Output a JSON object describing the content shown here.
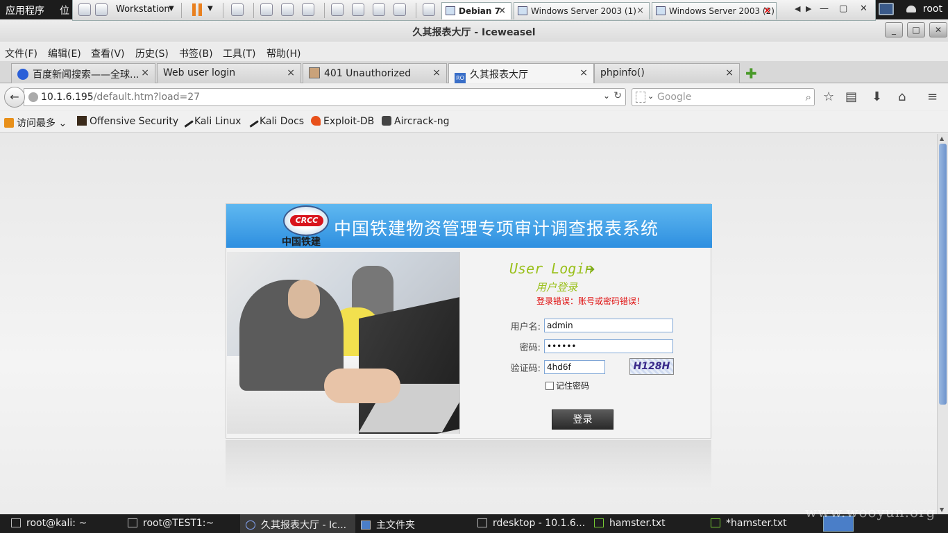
{
  "system": {
    "apps": "应用程序",
    "places": "位",
    "user": "root"
  },
  "vmware": {
    "workstation": "Workstation",
    "tabs": [
      {
        "label": "Debian 7",
        "active": true
      },
      {
        "label": "Windows Server 2003 (1)",
        "active": false
      },
      {
        "label": "Windows Server 2003 (2)",
        "active": false
      }
    ]
  },
  "window": {
    "title": "久其报表大厅 - Iceweasel"
  },
  "menu": [
    "文件(F)",
    "编辑(E)",
    "查看(V)",
    "历史(S)",
    "书签(B)",
    "工具(T)",
    "帮助(H)"
  ],
  "tabs": [
    {
      "label": "百度新闻搜索——全球...",
      "active": false
    },
    {
      "label": "Web user login",
      "active": false
    },
    {
      "label": "401 Unauthorized",
      "active": false
    },
    {
      "label": "久其报表大厅",
      "active": true
    },
    {
      "label": "phpinfo()",
      "active": false
    }
  ],
  "nav": {
    "url_host": "10.1.6.195",
    "url_path": "/default.htm?load=27",
    "search_placeholder": "Google"
  },
  "bookmarks": [
    "访问最多",
    "Offensive Security",
    "Kali Linux",
    "Kali Docs",
    "Exploit-DB",
    "Aircrack-ng"
  ],
  "page": {
    "logo_text": "CRCC",
    "logo_name": "中国铁建",
    "banner_title": "中国铁建物资管理专项审计调查报表系统",
    "login_title": "User Login",
    "login_title_cn": "用户登录",
    "error": "登录错误：账号或密码错误！",
    "username_label": "用户名:",
    "username_value": "admin",
    "password_label": "密码:",
    "password_value": "••••••",
    "captcha_label": "验证码:",
    "captcha_value": "4hd6f",
    "captcha_image_text": "H128H",
    "remember_label": "记住密码",
    "login_button": "登录"
  },
  "taskbar": [
    {
      "label": "root@kali: ~",
      "active": false
    },
    {
      "label": "root@TEST1:~",
      "active": false
    },
    {
      "label": "久其报表大厅 - Ic...",
      "active": true
    },
    {
      "label": "主文件夹",
      "active": false
    },
    {
      "label": "rdesktop - 10.1.6...",
      "active": false
    },
    {
      "label": "hamster.txt",
      "active": false
    },
    {
      "label": "*hamster.txt",
      "active": false
    }
  ],
  "watermark": "www.wooyun.org",
  "colors": {
    "banner": "#3aa0e8",
    "accent": "#9ac01b",
    "error": "#e01010"
  }
}
